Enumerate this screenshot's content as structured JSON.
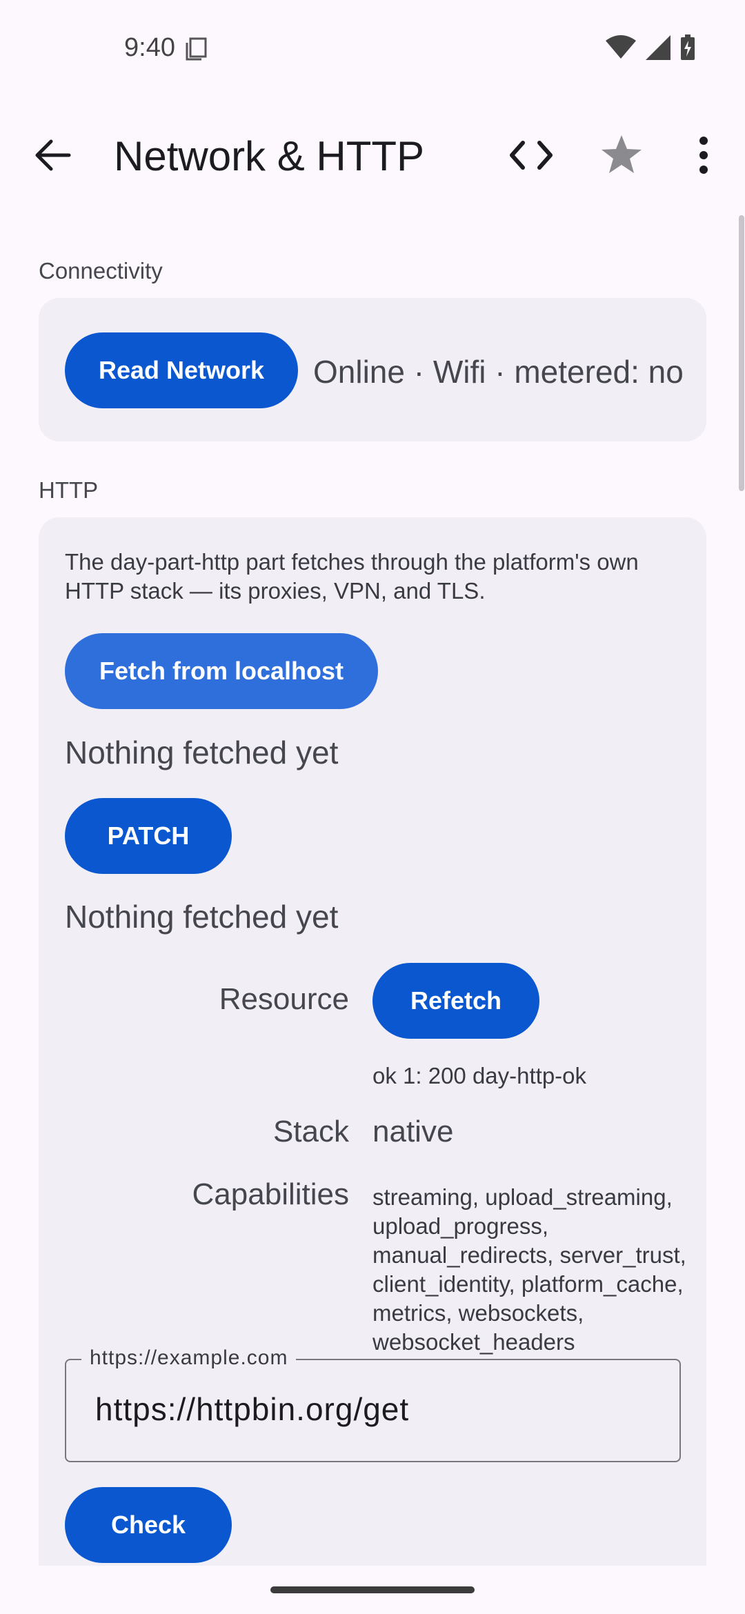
{
  "status_bar": {
    "time": "9:40"
  },
  "app_bar": {
    "title": "Network & HTTP"
  },
  "connectivity": {
    "section_label": "Connectivity",
    "read_button": "Read Network",
    "status_text": "Online · Wifi · metered: no"
  },
  "http": {
    "section_label": "HTTP",
    "description": "The day-part-http part fetches through the platform's own HTTP stack — its proxies, VPN, and TLS.",
    "fetch_button": "Fetch from localhost",
    "fetch_result": "Nothing fetched yet",
    "patch_button": "PATCH",
    "patch_result": "Nothing fetched yet",
    "resource_label": "Resource",
    "refetch_button": "Refetch",
    "resource_result": "ok 1: 200 day-http-ok",
    "stack_label": "Stack",
    "stack_value": "native",
    "capabilities_label": "Capabilities",
    "capabilities_value": "streaming, upload_streaming, upload_progress, manual_redirects, server_trust, client_identity, platform_cache, metrics, websockets, websocket_headers",
    "url_field_label": "https://example.com",
    "url_field_value": "https://httpbin.org/get",
    "check_button": "Check"
  }
}
